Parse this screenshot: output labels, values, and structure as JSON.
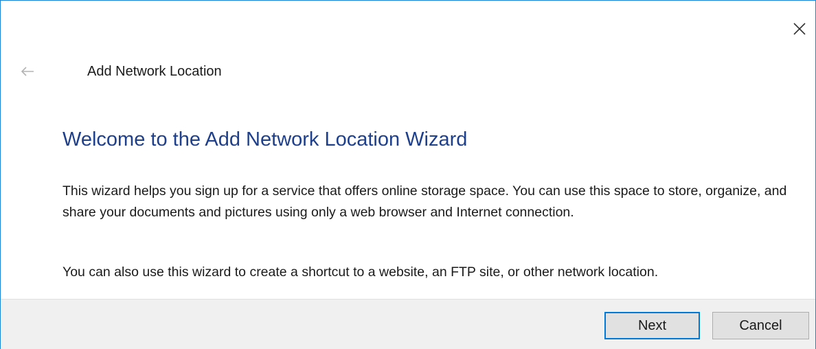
{
  "window": {
    "title": "Add Network Location"
  },
  "content": {
    "heading": "Welcome to the Add Network Location Wizard",
    "paragraph1": "This wizard helps you sign up for a service that offers online storage space.  You can use this space to store, organize, and share your documents and pictures using only a web browser and Internet connection.",
    "paragraph2": "You can also use this wizard to create a shortcut to a website, an FTP site, or other network location."
  },
  "buttons": {
    "next": "Next",
    "cancel": "Cancel"
  },
  "icons": {
    "close": "close-icon",
    "back": "back-arrow-icon"
  },
  "colors": {
    "heading": "#1e3f8c",
    "accent": "#0078d7",
    "footer_bg": "#f0f0f0"
  }
}
